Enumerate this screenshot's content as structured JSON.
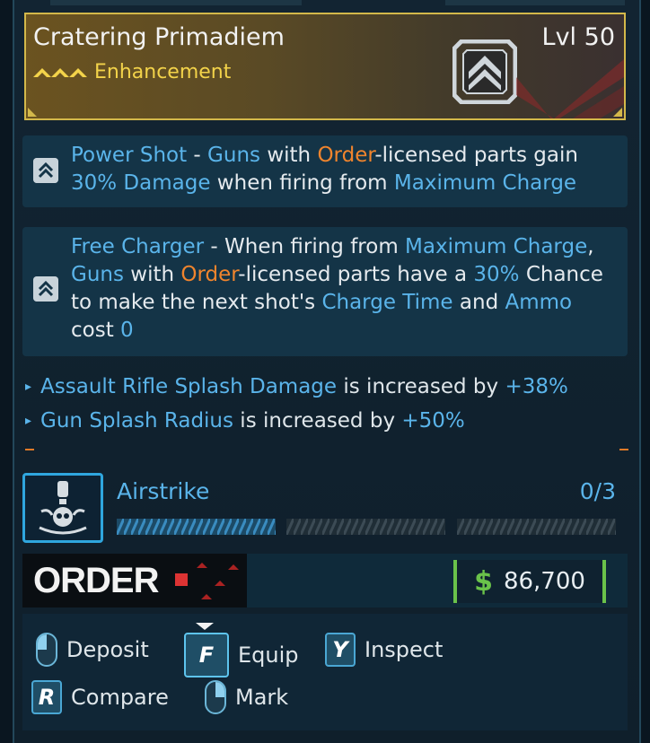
{
  "item": {
    "name": "Cratering Primadiem",
    "rarity": "Enhancement",
    "level": "Lvl 50",
    "icon": "enhancement-chevron-icon"
  },
  "perks": [
    {
      "icon": "chevron-up-icon",
      "segments": [
        {
          "t": "Power Shot",
          "c": "blue"
        },
        {
          "t": " - ",
          "c": "plain"
        },
        {
          "t": "Guns",
          "c": "blue"
        },
        {
          "t": " with ",
          "c": "plain"
        },
        {
          "t": "Order",
          "c": "orange"
        },
        {
          "t": "-licensed parts gain ",
          "c": "plain"
        },
        {
          "t": "30% Damage",
          "c": "blue"
        },
        {
          "t": " when firing from ",
          "c": "plain"
        },
        {
          "t": "Maximum Charge",
          "c": "blue"
        }
      ]
    },
    {
      "icon": "chevron-up-icon",
      "segments": [
        {
          "t": "Free Charger",
          "c": "blue"
        },
        {
          "t": " - When firing from ",
          "c": "plain"
        },
        {
          "t": "Maximum Charge",
          "c": "blue"
        },
        {
          "t": ", ",
          "c": "plain"
        },
        {
          "t": "Guns",
          "c": "blue"
        },
        {
          "t": " with ",
          "c": "plain"
        },
        {
          "t": "Order",
          "c": "orange"
        },
        {
          "t": "-licensed parts have a ",
          "c": "plain"
        },
        {
          "t": "30%",
          "c": "blue"
        },
        {
          "t": " Chance to make the next shot's ",
          "c": "plain"
        },
        {
          "t": "Charge Time",
          "c": "blue"
        },
        {
          "t": " and ",
          "c": "plain"
        },
        {
          "t": "Ammo",
          "c": "blue"
        },
        {
          "t": " cost ",
          "c": "plain"
        },
        {
          "t": "0",
          "c": "blue"
        }
      ]
    }
  ],
  "stats": [
    {
      "name": "Assault Rifle Splash Damage",
      "mid": " is increased by ",
      "value": "+38%"
    },
    {
      "name": "Gun Splash Radius",
      "mid": " is increased by ",
      "value": "+50%"
    }
  ],
  "skill": {
    "name": "Airstrike",
    "count": "0/3",
    "icon": "airstrike-skull-icon",
    "progress_segments_filled": 0
  },
  "manufacturer": {
    "logo_text": "ORDER",
    "currency_symbol": "$",
    "price": "86,700"
  },
  "actions": [
    {
      "key": "mouse-left",
      "label": "Deposit"
    },
    {
      "key": "F",
      "label": "Equip"
    },
    {
      "key": "Y",
      "label": "Inspect"
    },
    {
      "key": "R",
      "label": "Compare"
    },
    {
      "key": "mouse-right",
      "label": "Mark"
    }
  ],
  "colors": {
    "accent_blue": "#5ab4ea",
    "order_orange": "#f0842d",
    "rarity_gold": "#f3d34a",
    "price_green": "#6ac24a"
  }
}
